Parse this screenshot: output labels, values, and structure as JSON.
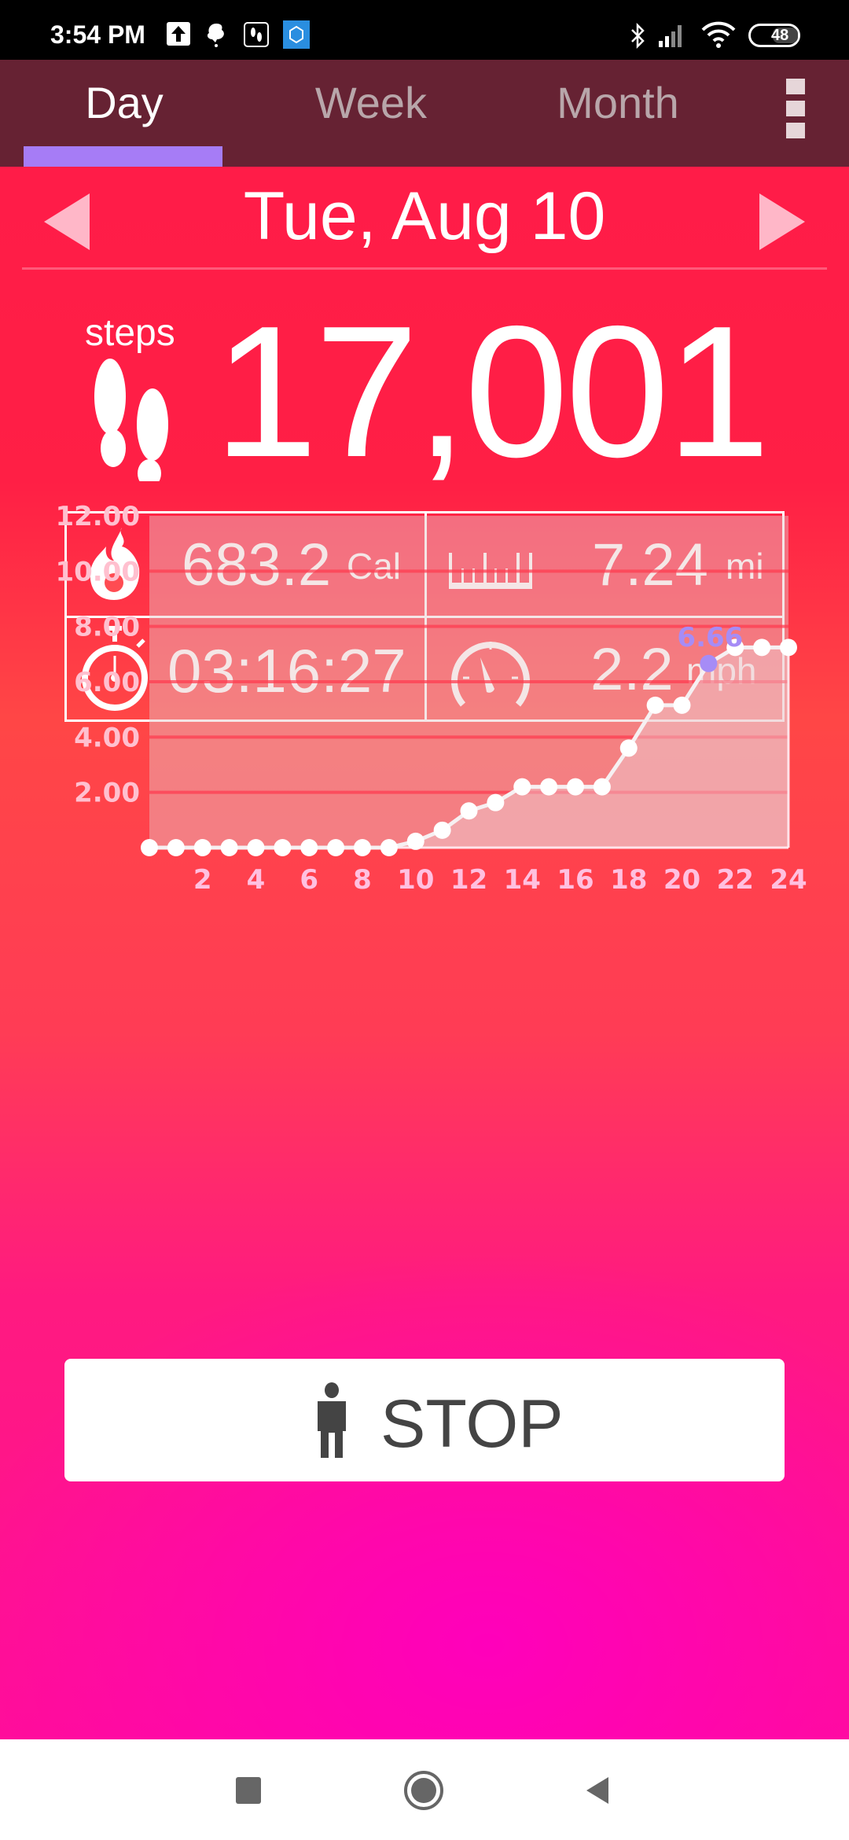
{
  "status_bar": {
    "time": "3:54 PM",
    "notification_icons": [
      "upload-icon",
      "bug-icon",
      "footsteps-app-icon",
      "mi-app-icon"
    ],
    "system_icons": [
      "bluetooth-icon",
      "signal-icon",
      "wifi-icon"
    ],
    "battery": "48"
  },
  "tabs": [
    {
      "label": "Day",
      "active": true
    },
    {
      "label": "Week",
      "active": false
    },
    {
      "label": "Month",
      "active": false
    }
  ],
  "colors": {
    "tab_bar": "#662233",
    "tab_indicator": "#a67cf6",
    "highlight": "#a68cf6",
    "background_top": "#ff1c48",
    "background_bottom": "#ff0e98"
  },
  "date": "Tue, Aug 10",
  "steps": {
    "label": "steps",
    "value": "17,001"
  },
  "stats": {
    "calories": {
      "value": "683.2",
      "unit": "Cal"
    },
    "distance": {
      "value": "7.24",
      "unit": "mi"
    },
    "duration": {
      "value": "03:16:27"
    },
    "speed": {
      "value": "2.2",
      "unit": "mph"
    }
  },
  "chart_data": {
    "type": "line",
    "title": "",
    "xlabel": "",
    "ylabel": "",
    "x": [
      0,
      1,
      2,
      3,
      4,
      5,
      6,
      7,
      8,
      9,
      10,
      11,
      12,
      13,
      14,
      15,
      16,
      17,
      18,
      19,
      20,
      21,
      22,
      23,
      24
    ],
    "values": [
      0,
      0,
      0,
      0,
      0,
      0,
      0,
      0,
      0,
      0,
      0.23,
      0.63,
      1.33,
      1.63,
      2.2,
      2.2,
      2.2,
      2.2,
      3.6,
      5.15,
      5.15,
      6.66,
      7.24,
      7.24,
      7.24
    ],
    "xticks": [
      "2",
      "4",
      "6",
      "8",
      "10",
      "12",
      "14",
      "16",
      "18",
      "20",
      "22",
      "24"
    ],
    "yticks": [
      "2.00",
      "4.00",
      "6.00",
      "8.00",
      "10.00",
      "12.00"
    ],
    "ylim": [
      0,
      12
    ],
    "xlim": [
      0,
      24
    ],
    "grid": true,
    "highlight": {
      "index": 21,
      "label": "6.66"
    }
  },
  "stop_button": {
    "label": "STOP"
  },
  "nav": [
    "recents-button",
    "home-button",
    "back-button"
  ]
}
